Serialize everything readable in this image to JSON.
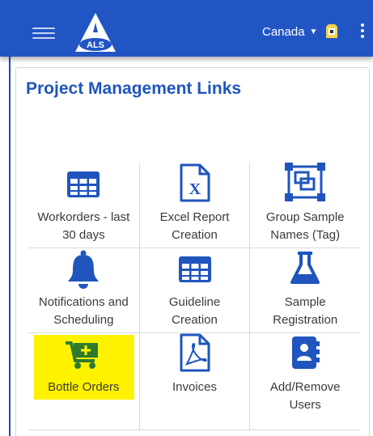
{
  "app": {
    "logo_text": "ALS",
    "region": "Canada",
    "colors": {
      "brand": "#2255c4",
      "icon": "#1f55bd",
      "highlight": "#fff200",
      "cart": "#2d7a2d"
    }
  },
  "panel": {
    "title": "Project Management Links"
  },
  "links": [
    {
      "label_line1": "Workorders - last",
      "label_line2": "30 days",
      "icon": "table-grid-icon"
    },
    {
      "label_line1": "Excel Report",
      "label_line2": "Creation",
      "icon": "excel-document-icon"
    },
    {
      "label_line1": "Group Sample",
      "label_line2": "Names (Tag)",
      "icon": "group-select-icon"
    },
    {
      "label_line1": "Notifications and",
      "label_line2": "Scheduling",
      "icon": "bell-icon"
    },
    {
      "label_line1": "Guideline",
      "label_line2": "Creation",
      "icon": "table-grid-icon"
    },
    {
      "label_line1": "Sample",
      "label_line2": "Registration",
      "icon": "flask-icon"
    },
    {
      "label_line1": "Bottle Orders",
      "label_line2": "",
      "icon": "add-to-cart-icon",
      "highlighted": true
    },
    {
      "label_line1": "Invoices",
      "label_line2": "",
      "icon": "pdf-document-icon"
    },
    {
      "label_line1": "Add/Remove",
      "label_line2": "Users",
      "icon": "address-book-icon"
    }
  ]
}
